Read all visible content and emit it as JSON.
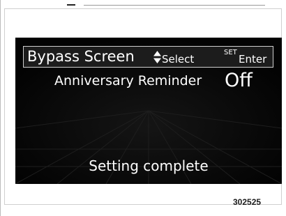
{
  "header": {
    "title": "Bypass Screen",
    "select_icon": "up-down-triangle-icon",
    "select_label": "Select",
    "set_label": "SET",
    "enter_label": "Enter"
  },
  "setting": {
    "name": "Anniversary Reminder",
    "value": "Off"
  },
  "status": {
    "message": "Setting complete"
  },
  "figure": {
    "id": "302525"
  },
  "colors": {
    "screen_background": "#050505",
    "header_background": "#1c1c1c",
    "header_border": "#d0d0d0",
    "text": "#ffffff"
  }
}
